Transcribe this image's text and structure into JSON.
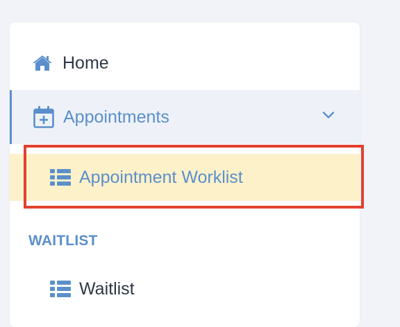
{
  "sidebar": {
    "home_label": "Home",
    "appointments_label": "Appointments",
    "worklist_label": "Appointment Worklist",
    "section_label": "WAITLIST",
    "waitlist_label": "Waitlist"
  },
  "icons": {
    "home": "home-icon",
    "appointments": "calendar-plus-icon",
    "expand": "chevron-down-icon",
    "worklist": "list-icon",
    "waitlist": "list-icon"
  },
  "colors": {
    "accent": "#5b8fcb",
    "text": "#2f3845",
    "selected_bg": "#fdf1c9",
    "active_group_bg": "#eef2f8",
    "annotation_box": "#e2412f"
  }
}
